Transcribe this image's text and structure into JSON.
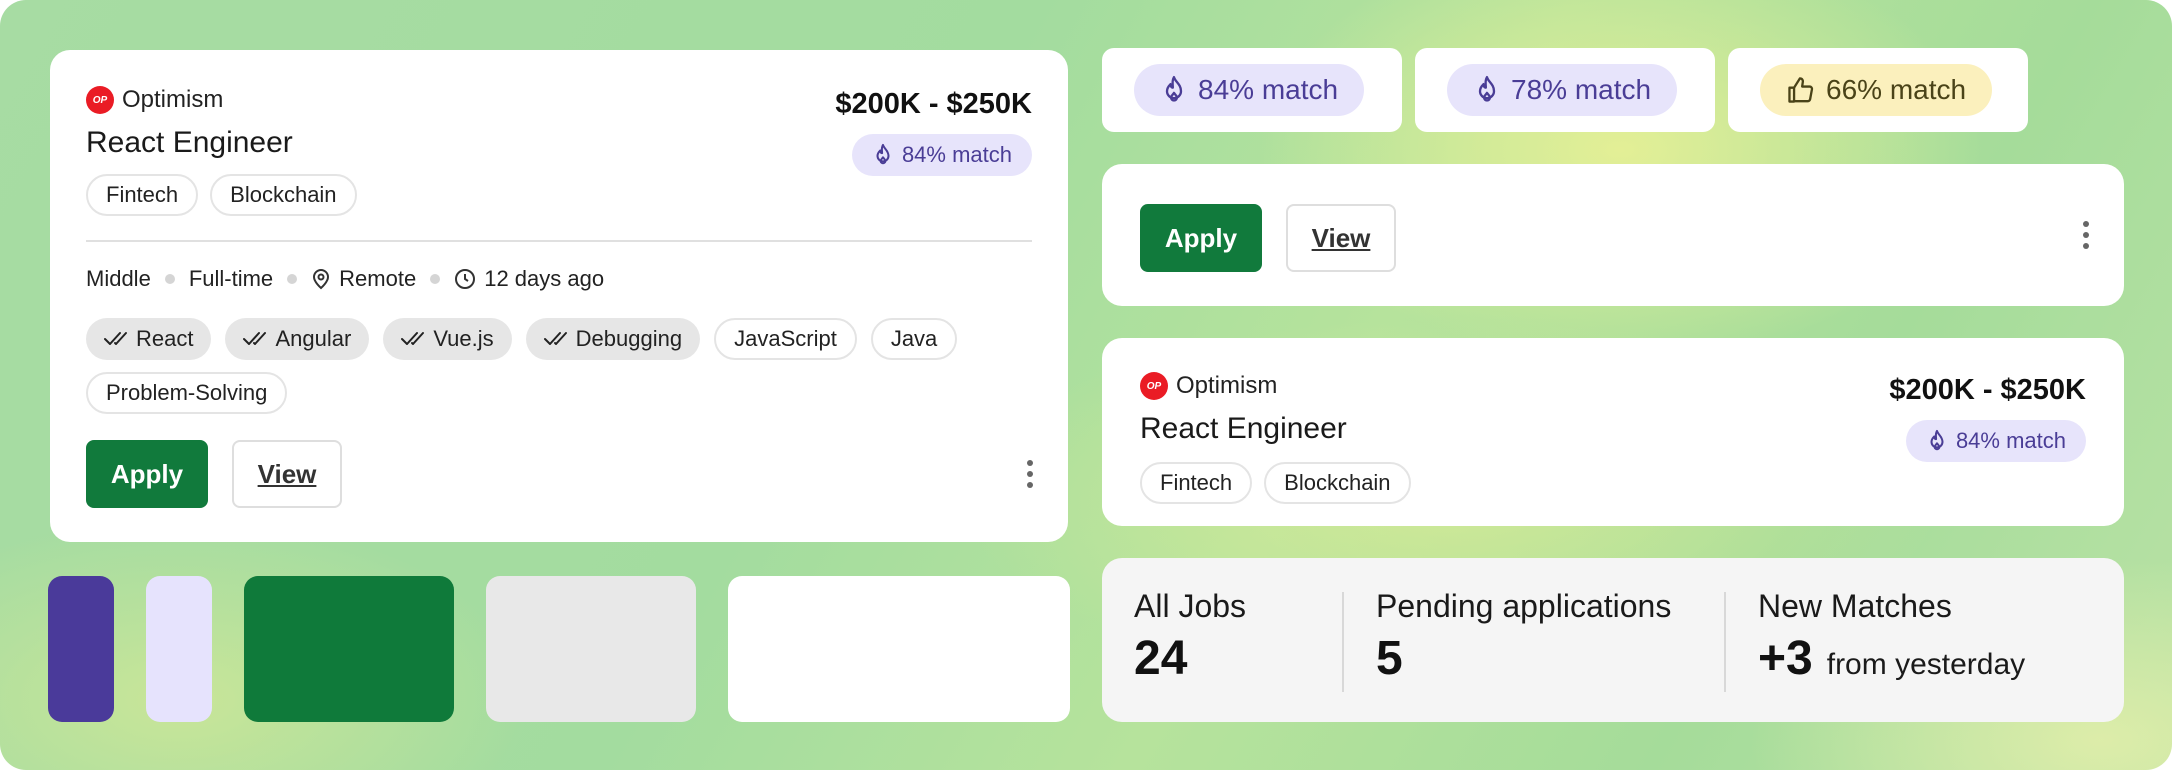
{
  "job_card": {
    "company": "Optimism",
    "logo_text": "OP",
    "title": "React Engineer",
    "salary": "$200K - $250K",
    "match": "84% match",
    "tags": [
      "Fintech",
      "Blockchain"
    ],
    "meta": {
      "level": "Middle",
      "type": "Full-time",
      "location": "Remote",
      "posted": "12 days ago"
    },
    "skills_matched": [
      "React",
      "Angular",
      "Vue.js",
      "Debugging"
    ],
    "skills_other": [
      "JavaScript",
      "Java",
      "Problem-Solving"
    ],
    "apply_label": "Apply",
    "view_label": "View"
  },
  "swatch_colors": [
    "#4a3a9a",
    "#e6e3fd",
    "#0f7a3a",
    "#e8e8e8",
    "#ffffff"
  ],
  "match_badges": [
    {
      "label": "84% match",
      "icon": "flame-icon",
      "style": "purple"
    },
    {
      "label": "78% match",
      "icon": "flame-icon",
      "style": "purple"
    },
    {
      "label": "66% match",
      "icon": "thumbs-up-icon",
      "style": "yellow"
    }
  ],
  "action_bar": {
    "apply_label": "Apply",
    "view_label": "View"
  },
  "job_card_compact": {
    "company": "Optimism",
    "logo_text": "OP",
    "title": "React Engineer",
    "salary": "$200K - $250K",
    "match": "84% match",
    "tags": [
      "Fintech",
      "Blockchain"
    ]
  },
  "stats": {
    "all_jobs_label": "All Jobs",
    "all_jobs_value": "24",
    "pending_label": "Pending applications",
    "pending_value": "5",
    "new_matches_label": "New Matches",
    "new_matches_value": "+3",
    "new_matches_sub": "from yesterday"
  },
  "colors": {
    "primary_green": "#117a3c",
    "match_purple_bg": "#e7e4fb",
    "match_purple_text": "#4a3d96",
    "match_yellow_bg": "#fbf0bd",
    "logo_red": "#ea1c25"
  }
}
